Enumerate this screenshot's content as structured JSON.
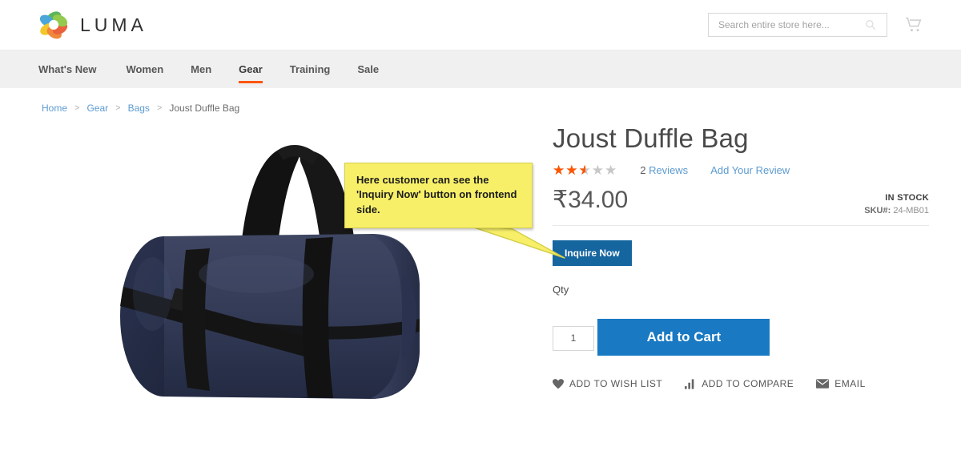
{
  "header": {
    "logo_text": "LUMA",
    "logo_icon": "luma-ring-logo",
    "search": {
      "placeholder": "Search entire store here...",
      "value": "",
      "icon": "search-icon"
    },
    "cart_icon": "shopping-cart-icon"
  },
  "nav": {
    "items": [
      {
        "label": "What's New",
        "active": false
      },
      {
        "label": "Women",
        "active": false
      },
      {
        "label": "Men",
        "active": false
      },
      {
        "label": "Gear",
        "active": true
      },
      {
        "label": "Training",
        "active": false
      },
      {
        "label": "Sale",
        "active": false
      }
    ],
    "active_underline_color": "#ff5501"
  },
  "breadcrumb": {
    "items": [
      {
        "label": "Home",
        "link": true
      },
      {
        "label": "Gear",
        "link": true
      },
      {
        "label": "Bags",
        "link": true
      },
      {
        "label": "Joust Duffle Bag",
        "link": false
      }
    ],
    "separator": ">"
  },
  "product": {
    "title": "Joust Duffle Bag",
    "image_alt": "navy-duffle-bag",
    "rating": {
      "value": 2.5,
      "max": 5,
      "percent": 50,
      "filled_color": "#ff5501",
      "empty_color": "#c7c7c7",
      "reviews_count": "2",
      "reviews_label": "Reviews",
      "add_review_label": "Add Your Review"
    },
    "price": "₹34.00",
    "stock_status": "IN STOCK",
    "sku_label": "SKU#:",
    "sku_value": "24-MB01",
    "inquire_button": "Inquire Now",
    "inquire_button_color": "#15659f",
    "qty_label": "Qty",
    "qty_value": "1",
    "add_to_cart_label": "Add to Cart",
    "add_to_cart_color": "#1979c3",
    "social_links": [
      {
        "label": "ADD TO WISH LIST",
        "icon": "heart-icon"
      },
      {
        "label": "ADD TO COMPARE",
        "icon": "bar-chart-icon"
      },
      {
        "label": "EMAIL",
        "icon": "envelope-icon"
      }
    ]
  },
  "annotation": {
    "text": "Here customer can see the 'Inquiry Now' button on frontend side.",
    "background_color": "#f7ef68",
    "border_color": "#d6cf4a"
  }
}
